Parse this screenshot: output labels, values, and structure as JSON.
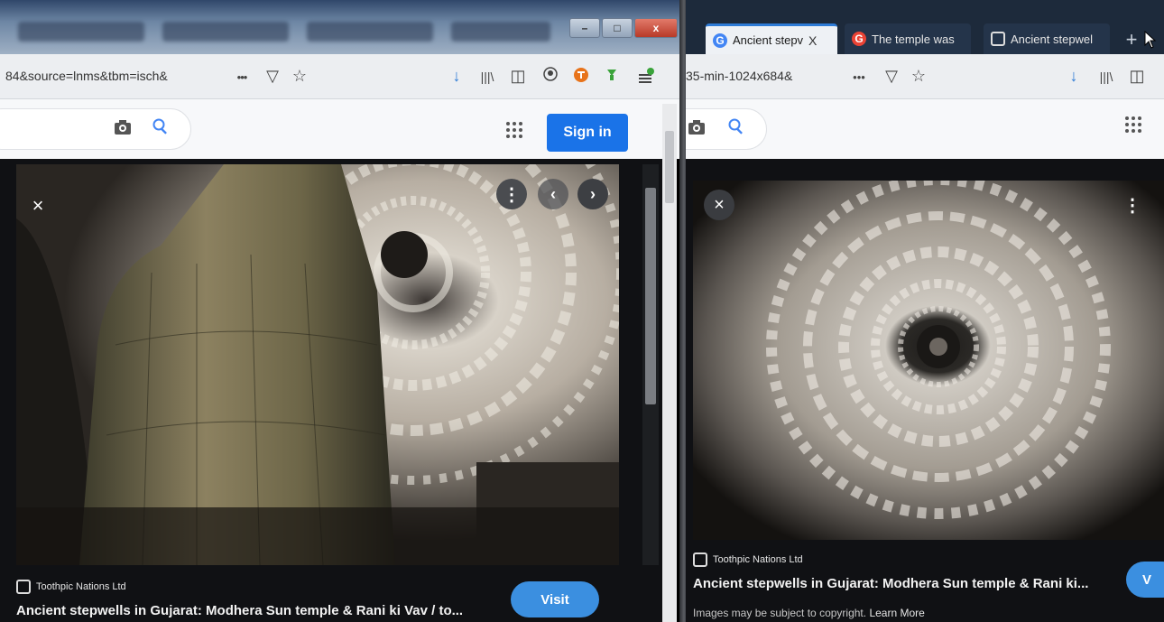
{
  "left_window": {
    "url": "84&source=lnms&tbm=isch&",
    "controls": {
      "minimize": "–",
      "maximize": "□",
      "close": "x"
    },
    "sign_in_label": "Sign in",
    "source": "Toothpic Nations Ltd",
    "caption": "Ancient stepwells in Gujarat: Modhera Sun temple & Rani ki Vav / to...",
    "visit_label": "Visit",
    "close_label": "×"
  },
  "right_window": {
    "tabs": [
      {
        "title": "Ancient stepv",
        "icon_text": "G",
        "color": "#4285f4"
      },
      {
        "title": "The temple was",
        "icon_text": "G",
        "color": "#ea4335"
      },
      {
        "title": "Ancient stepwel",
        "icon_text": "",
        "color": "#444444"
      }
    ],
    "tab_close": "X",
    "new_tab": "+",
    "url": "35-min-1024x684&",
    "source": "Toothpic Nations Ltd",
    "caption": "Ancient stepwells in Gujarat: Modhera Sun temple & Rani ki...",
    "copyright_text": "Images may be subject to copyright.",
    "learn_more": "Learn More",
    "visit_label": "V",
    "close_label": "×"
  },
  "icons": {
    "more": "•••",
    "pocket": "▽",
    "bookmark": "☆",
    "download": "↓",
    "library": "|||\\",
    "sidebar": "◫",
    "camera": "◙",
    "search": "⚲",
    "apps": "∷∷",
    "kebab": "⋮",
    "prev": "‹",
    "next": "›"
  },
  "colors": {
    "accent_blue": "#1a73e8",
    "visit_blue": "#3b8fe0",
    "addon_orange": "#e8731a",
    "addon_green": "#3aa33a"
  }
}
